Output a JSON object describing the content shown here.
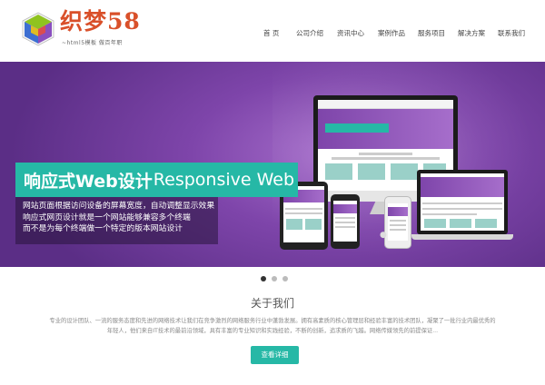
{
  "header": {
    "logo_text": "织梦58",
    "logo_tagline": "~html5模板  做百年职",
    "nav": [
      "首 页",
      "公司介绍",
      "资讯中心",
      "案例作品",
      "服务项目",
      "解决方案",
      "联系我们"
    ]
  },
  "banner": {
    "headline_cn": "响应式Web设计",
    "headline_en": "Responsive Web",
    "lines": [
      "网站页面根据访问设备的屏幕宽度，自动调整显示效果",
      "响应式网页设计就是一个网站能够兼容多个终端",
      "而不是为每个终端做一个特定的版本网站设计"
    ],
    "active_slide": 1,
    "slide_count": 3
  },
  "about": {
    "title": "关于我们",
    "body_line1": "专业的设计团队、一流的服务态度和先进的网络技术让我们在竞争激烈的网络服务行业中蓬勃发展。拥有高素质的核心管理层和经验丰富的技术团队，凝聚了一批行业内最优秀的",
    "body_line2": "年轻人，他们来自IT技术的最前沿领域，具有丰富的专业知识和实践经验，不断的创新，追求质的飞越。网络传媒领先的前提保证...",
    "button_label": "查看详细"
  },
  "colors": {
    "accent": "#26b8a6",
    "logo": "#d9502a",
    "banner": "#7e45aa"
  }
}
